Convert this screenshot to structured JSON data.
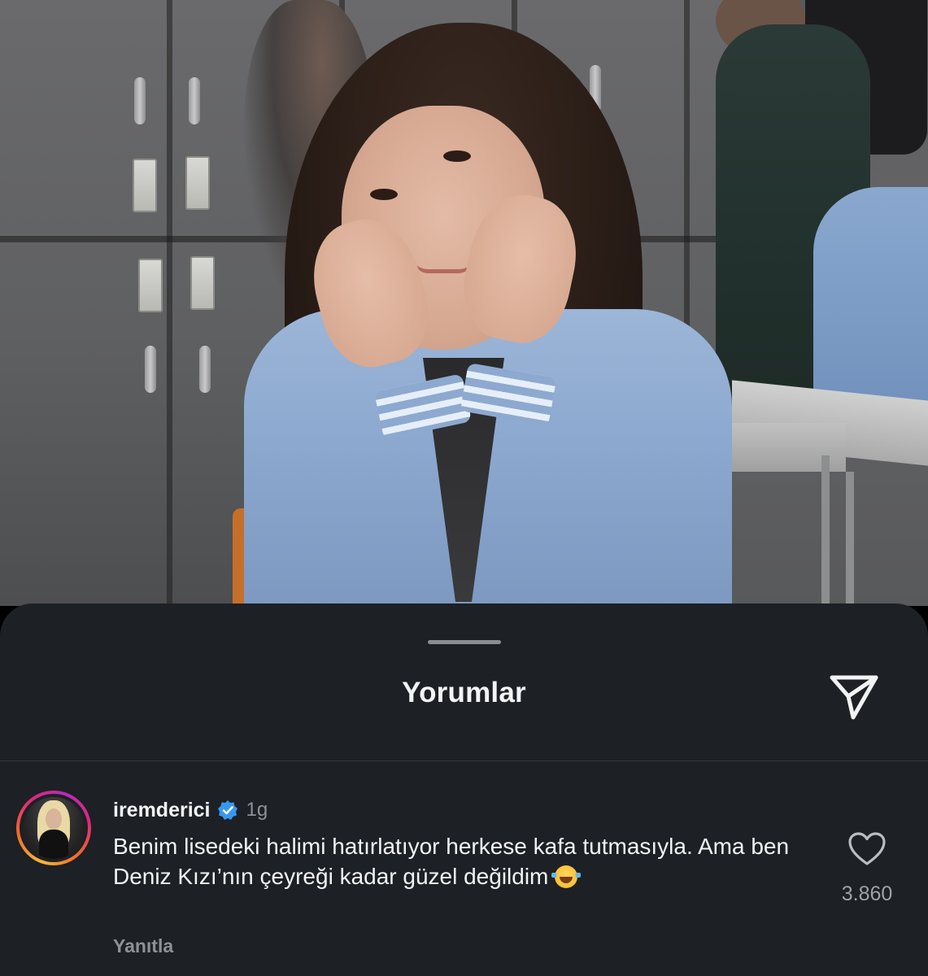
{
  "sheet": {
    "title": "Yorumlar"
  },
  "comment": {
    "username": "iremderici",
    "time": "1g",
    "text": "Benim lisedeki halimi hatırlatıyor herkese kafa tutmasıyla. Ama ben Deniz Kızı’nın çeyreği kadar güzel değildim",
    "emoji": "laughing-with-tears-icon",
    "reply_label": "Yanıtla",
    "like_count": "3.860",
    "verified": true
  },
  "colors": {
    "sheet_background": "#1d2024",
    "text_primary": "#f2f3f5",
    "text_secondary": "#8e9297",
    "verified_blue": "#3897f0"
  }
}
